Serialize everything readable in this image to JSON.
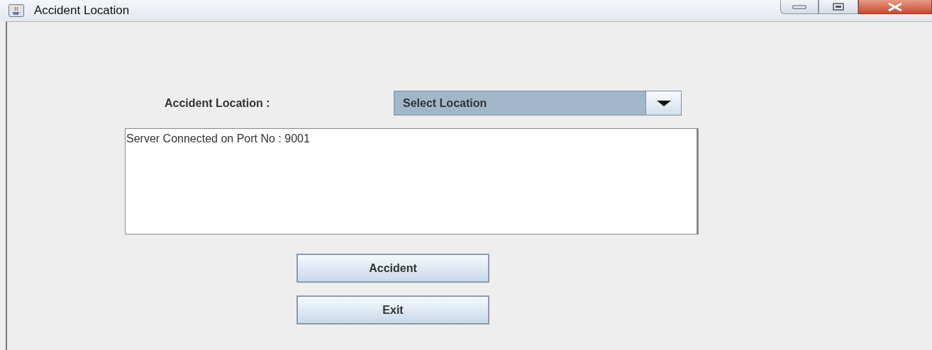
{
  "window": {
    "title": "Accident Location"
  },
  "location_label": "Accident Location :",
  "location_dropdown": {
    "value": "Select Location"
  },
  "log_area": {
    "value": "Server Connected on Port No : 9001"
  },
  "buttons": [
    "Accident",
    "Exit"
  ]
}
